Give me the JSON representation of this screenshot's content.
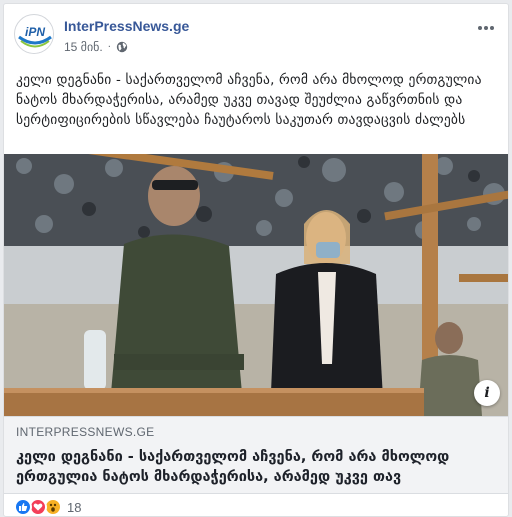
{
  "post": {
    "page_name": "InterPressNews.ge",
    "avatar_logo_text": "iPN",
    "time": "15 მინ.",
    "separator": "·",
    "privacy_icon": "globe-icon",
    "more_icon": "more-horizontal-icon",
    "text": "კელი დეგნანი - საქართველომ აჩვენა, რომ არა მხოლოდ ერთგულია ნატოს მხარდაჭერისა, არამედ უკვე თავად შეუძლია გაწვრთნის და სერტიფიცირების სწავლება ჩაუტაროს საკუთარ თავდაცვის ძალებს"
  },
  "photo": {
    "info_label": "i"
  },
  "link_preview": {
    "domain": "INTERPRESSNEWS.GE",
    "title": "კელი დეგნანი - საქართველომ აჩვენა, რომ არა მხოლოდ ერთგულია ნატოს მხარდაჭერისა, არამედ უკვე თავ"
  },
  "reactions": {
    "types": [
      "like",
      "love",
      "wow"
    ],
    "count": "18",
    "colors": {
      "like": "#1877f2",
      "love": "#f33e58",
      "wow": "#f7b125"
    }
  },
  "colors": {
    "link_blue": "#385898",
    "muted": "#606770",
    "bg": "#e9ebee"
  }
}
